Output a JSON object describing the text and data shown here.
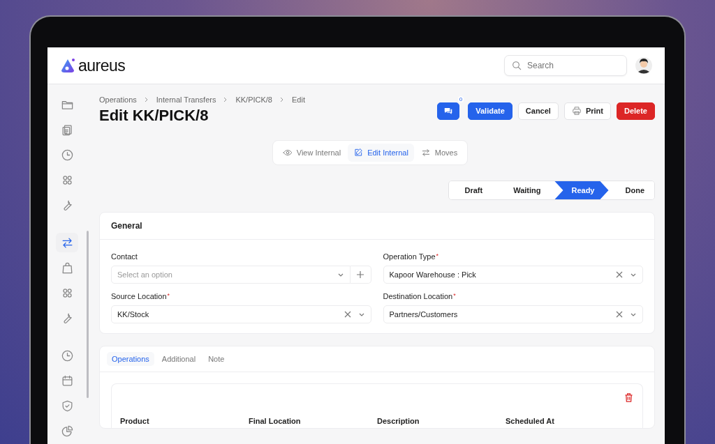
{
  "brand": {
    "name": "aureus"
  },
  "search": {
    "placeholder": "Search"
  },
  "sidebar": {
    "groups": [
      {
        "items": [
          {
            "kind": "folder",
            "selected": false
          },
          {
            "kind": "clipboard",
            "selected": false
          },
          {
            "kind": "clock",
            "selected": false
          },
          {
            "kind": "grid",
            "selected": false
          },
          {
            "kind": "wrench",
            "selected": false
          }
        ]
      },
      {
        "items": [
          {
            "kind": "transfer",
            "selected": true
          },
          {
            "kind": "bag",
            "selected": false
          },
          {
            "kind": "grid",
            "selected": false
          },
          {
            "kind": "wrench",
            "selected": false
          }
        ]
      },
      {
        "items": [
          {
            "kind": "clock",
            "selected": false
          },
          {
            "kind": "calendar",
            "selected": false
          },
          {
            "kind": "shield",
            "selected": false
          },
          {
            "kind": "pie",
            "selected": false
          }
        ]
      }
    ]
  },
  "breadcrumb": [
    "Operations",
    "Internal Transfers",
    "KK/PICK/8",
    "Edit"
  ],
  "title": "Edit KK/PICK/8",
  "actions": {
    "chat_count": "0",
    "buttons": [
      {
        "label": "Validate",
        "kind": "primary"
      },
      {
        "label": "Cancel",
        "kind": "default"
      },
      {
        "label": "Print",
        "kind": "print"
      },
      {
        "label": "Delete",
        "kind": "danger"
      }
    ]
  },
  "view_tabs": [
    {
      "label": "View Internal",
      "kind": "eye",
      "selected": false
    },
    {
      "label": "Edit Internal",
      "kind": "pencil",
      "selected": true
    },
    {
      "label": "Moves",
      "kind": "transfer",
      "selected": false
    }
  ],
  "stages": [
    {
      "label": "Draft",
      "selected": false
    },
    {
      "label": "Waiting",
      "selected": false
    },
    {
      "label": "Ready",
      "selected": true
    },
    {
      "label": "Done",
      "selected": false
    }
  ],
  "general": {
    "title": "General",
    "fields": [
      {
        "label": "Contact",
        "kind": "select-add",
        "placeholder": "Select an option"
      },
      {
        "label": "Operation Type",
        "required_mark": "*",
        "kind": "select-clear",
        "value": "Kapoor Warehouse : Pick"
      },
      {
        "label": "Source Location",
        "required_mark": "*",
        "kind": "select-clear",
        "value": "KK/Stock"
      },
      {
        "label": "Destination Location",
        "required_mark": "*",
        "kind": "select-clear",
        "value": "Partners/Customers"
      }
    ]
  },
  "tabs": [
    {
      "label": "Operations",
      "selected": true
    },
    {
      "label": "Additional",
      "selected": false
    },
    {
      "label": "Note",
      "selected": false
    }
  ],
  "table": {
    "columns": [
      "Product",
      "Final Location",
      "Description",
      "Scheduled At"
    ]
  }
}
